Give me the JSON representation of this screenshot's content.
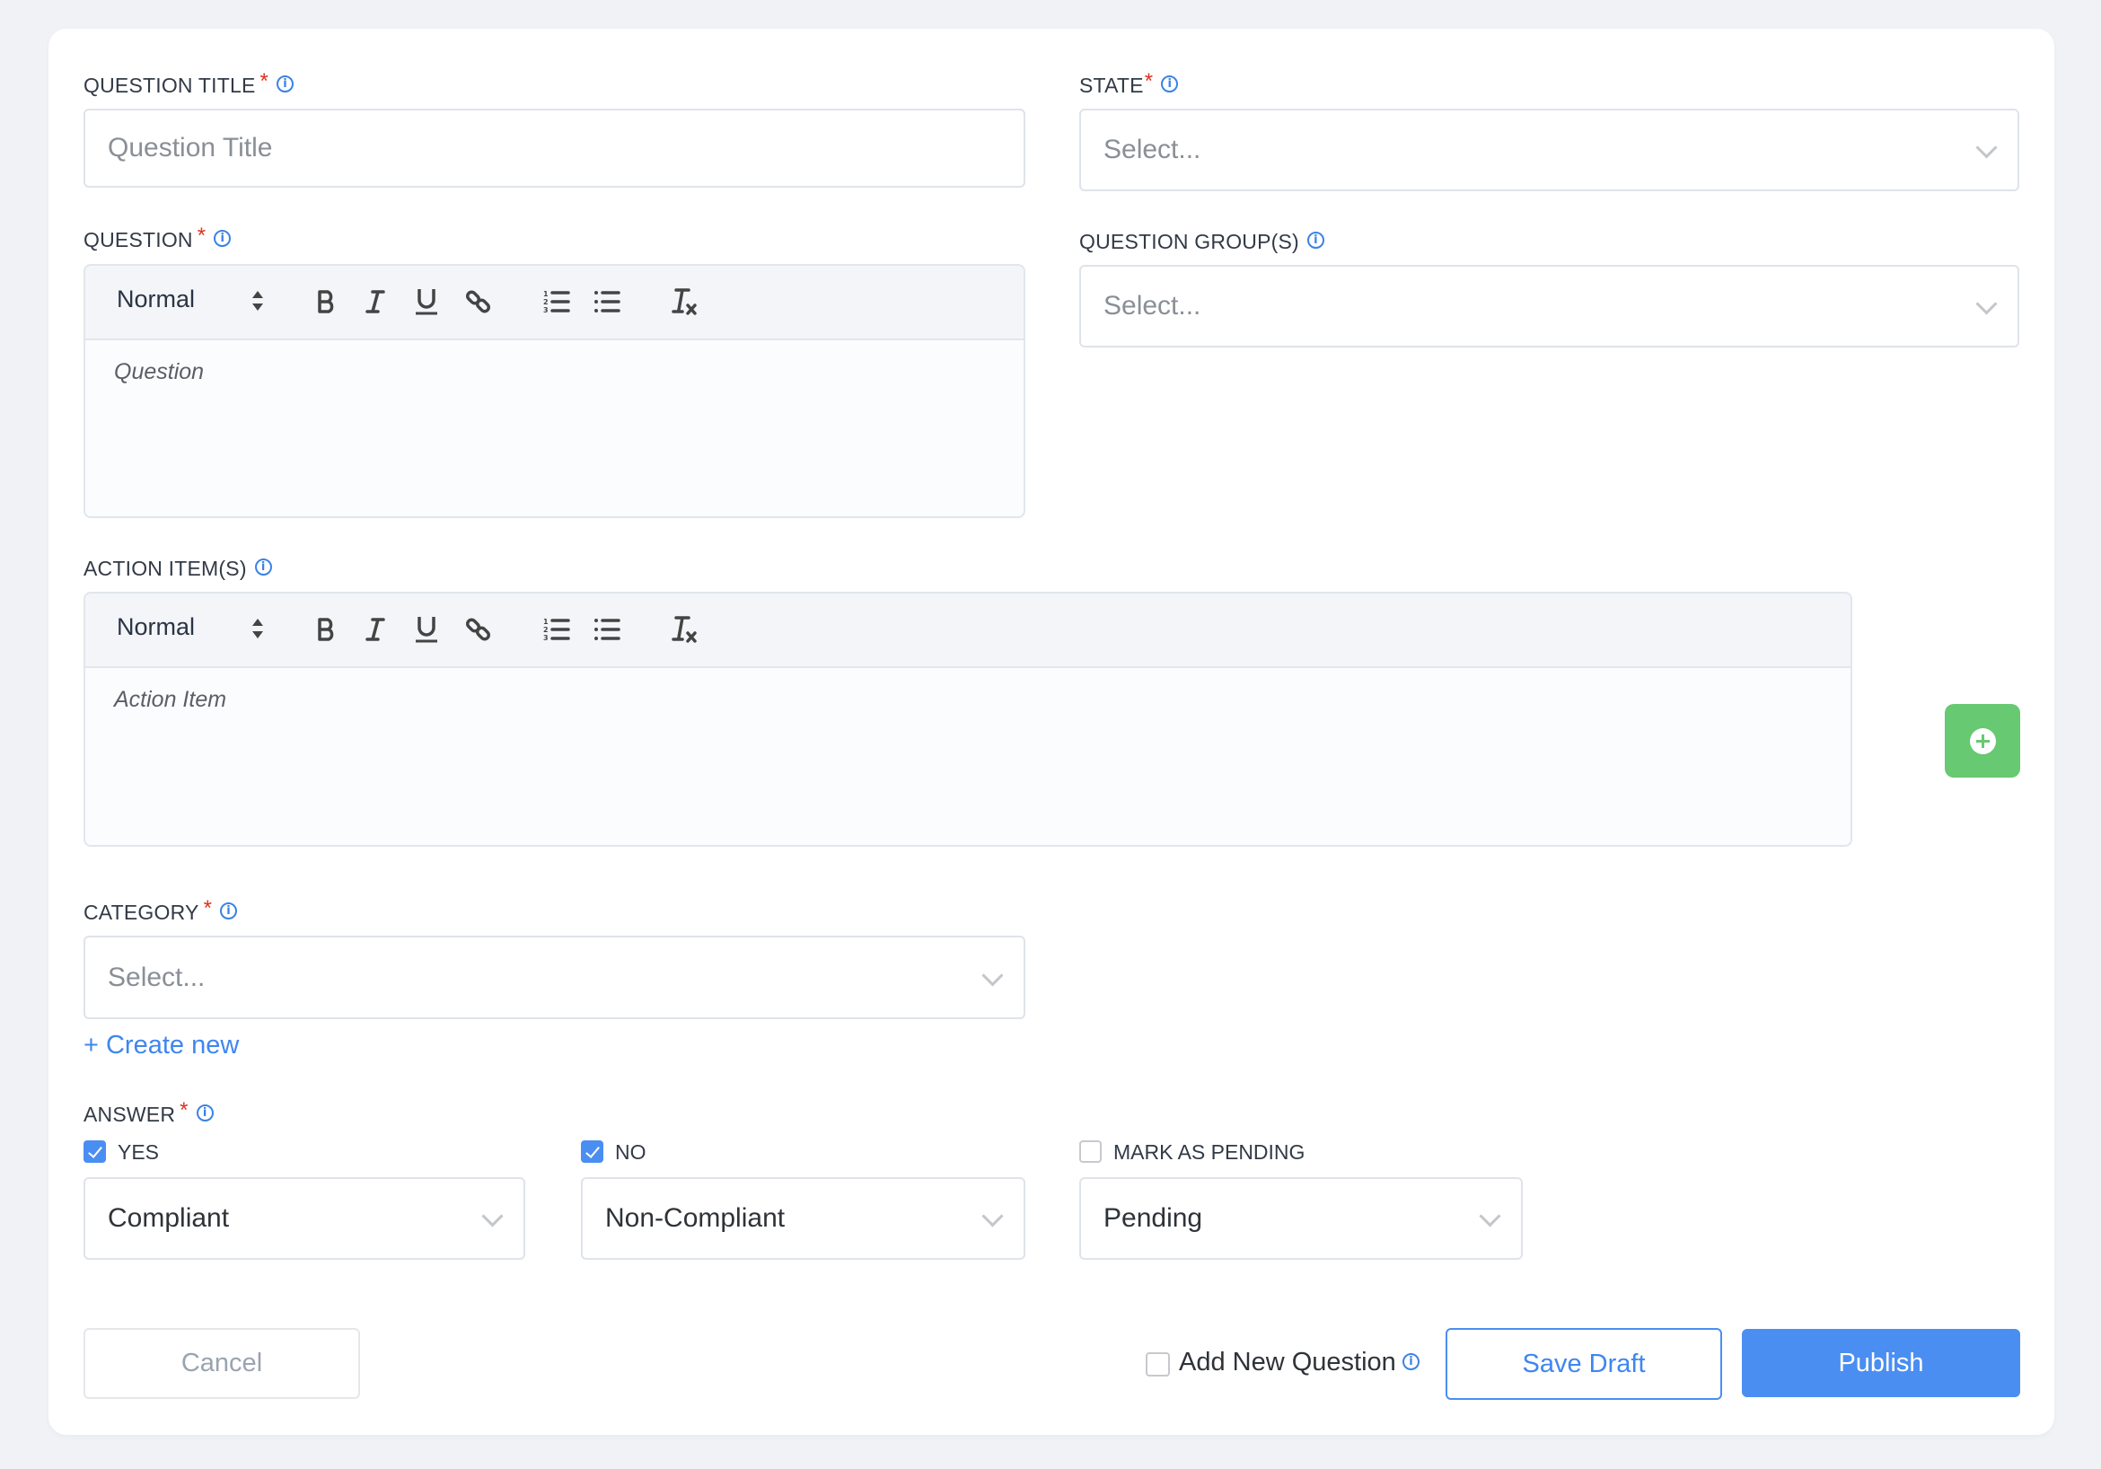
{
  "question_title": {
    "label": "QUESTION TITLE",
    "required_mark": "*",
    "info_icon": "info-circle-icon",
    "placeholder": "Question Title",
    "value": ""
  },
  "state": {
    "label": "STATE",
    "required_mark": "*",
    "info_icon": "info-circle-icon",
    "placeholder": "Select...",
    "selected": ""
  },
  "question": {
    "label": "QUESTION",
    "required_mark": "*",
    "info_icon": "info-circle-icon",
    "toolbar": {
      "format": "Normal",
      "buttons": [
        "bold",
        "italic",
        "underline",
        "link",
        "ordered-list",
        "bullet-list",
        "clear-format"
      ]
    },
    "placeholder": "Question"
  },
  "question_groups": {
    "label": "QUESTION GROUP(S)",
    "info_icon": "info-circle-icon",
    "placeholder": "Select..."
  },
  "action_items": {
    "label": "ACTION ITEM(S)",
    "info_icon": "info-circle-icon",
    "toolbar": {
      "format": "Normal",
      "buttons": [
        "bold",
        "italic",
        "underline",
        "link",
        "ordered-list",
        "bullet-list",
        "clear-format"
      ]
    },
    "placeholder": "Action Item",
    "add_button_icon": "plus-circle-icon"
  },
  "category": {
    "label": "CATEGORY",
    "required_mark": "*",
    "info_icon": "info-circle-icon",
    "placeholder": "Select...",
    "create_new": "+ Create new"
  },
  "answer": {
    "label": "ANSWER",
    "required_mark": "*",
    "info_icon": "info-circle-icon",
    "options": [
      {
        "label": "YES",
        "checked": true,
        "selected": "Compliant"
      },
      {
        "label": "NO",
        "checked": true,
        "selected": "Non-Compliant"
      },
      {
        "label": "MARK AS PENDING",
        "checked": false,
        "selected": "Pending"
      }
    ]
  },
  "footer": {
    "cancel": "Cancel",
    "add_new_question": {
      "label": "Add New Question",
      "checked": false
    },
    "save_draft": "Save Draft",
    "publish": "Publish"
  },
  "colors": {
    "accent": "#4a8ef2",
    "add_button": "#67c971",
    "required": "#e0301e"
  }
}
